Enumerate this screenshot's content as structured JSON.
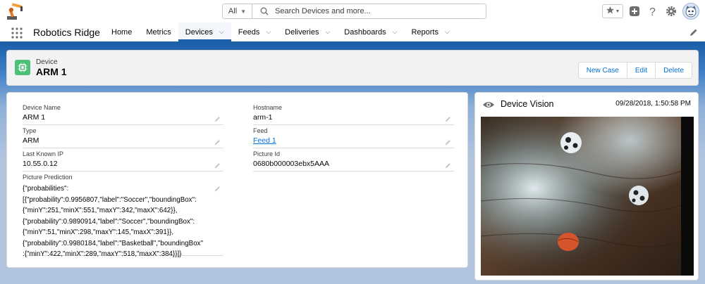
{
  "search": {
    "scope": "All",
    "placeholder": "Search Devices and more..."
  },
  "app": {
    "name": "Robotics Ridge"
  },
  "nav": {
    "items": [
      {
        "label": "Home",
        "dropdown": false,
        "active": false
      },
      {
        "label": "Metrics",
        "dropdown": false,
        "active": false
      },
      {
        "label": "Devices",
        "dropdown": true,
        "active": true
      },
      {
        "label": "Feeds",
        "dropdown": true,
        "active": false
      },
      {
        "label": "Deliveries",
        "dropdown": true,
        "active": false
      },
      {
        "label": "Dashboards",
        "dropdown": true,
        "active": false
      },
      {
        "label": "Reports",
        "dropdown": true,
        "active": false
      }
    ]
  },
  "record": {
    "type": "Device",
    "title": "ARM 1",
    "actions": {
      "new_case": "New Case",
      "edit": "Edit",
      "delete": "Delete"
    }
  },
  "details": {
    "device_name": {
      "label": "Device Name",
      "value": "ARM 1"
    },
    "hostname": {
      "label": "Hostname",
      "value": "arm-1"
    },
    "type": {
      "label": "Type",
      "value": "ARM"
    },
    "feed": {
      "label": "Feed",
      "value": "Feed 1"
    },
    "last_known_ip": {
      "label": "Last Known IP",
      "value": "10.55.0.12"
    },
    "picture_id": {
      "label": "Picture Id",
      "value": "0680b000003ebx5AAA"
    },
    "picture_prediction": {
      "label": "Picture Prediction",
      "value": "{\"probabilities\":\n[{\"probability\":0.9956807,\"label\":\"Soccer\",\"boundingBox\":\n{\"minY\":251,\"minX\":551,\"maxY\":342,\"maxX\":642}},\n{\"probability\":0.9890914,\"label\":\"Soccer\",\"boundingBox\":\n{\"minY\":51,\"minX\":298,\"maxY\":145,\"maxX\":391}},\n{\"probability\":0.9980184,\"label\":\"Basketball\",\"boundingBox\"\n:{\"minY\":422,\"minX\":289,\"maxY\":518,\"maxX\":384}}]}"
    }
  },
  "vision": {
    "title": "Device Vision",
    "timestamp": "09/28/2018, 1:50:58 PM"
  },
  "colors": {
    "brand": "#1b5fa8",
    "link": "#0070d2",
    "record_icon": "#4bc076"
  },
  "icons": [
    "robot-logo-icon",
    "search-icon",
    "star-icon",
    "plus-icon",
    "help-icon",
    "gear-icon",
    "avatar-icon",
    "app-launcher-icon",
    "pencil-icon",
    "chip-icon",
    "eye-icon"
  ]
}
